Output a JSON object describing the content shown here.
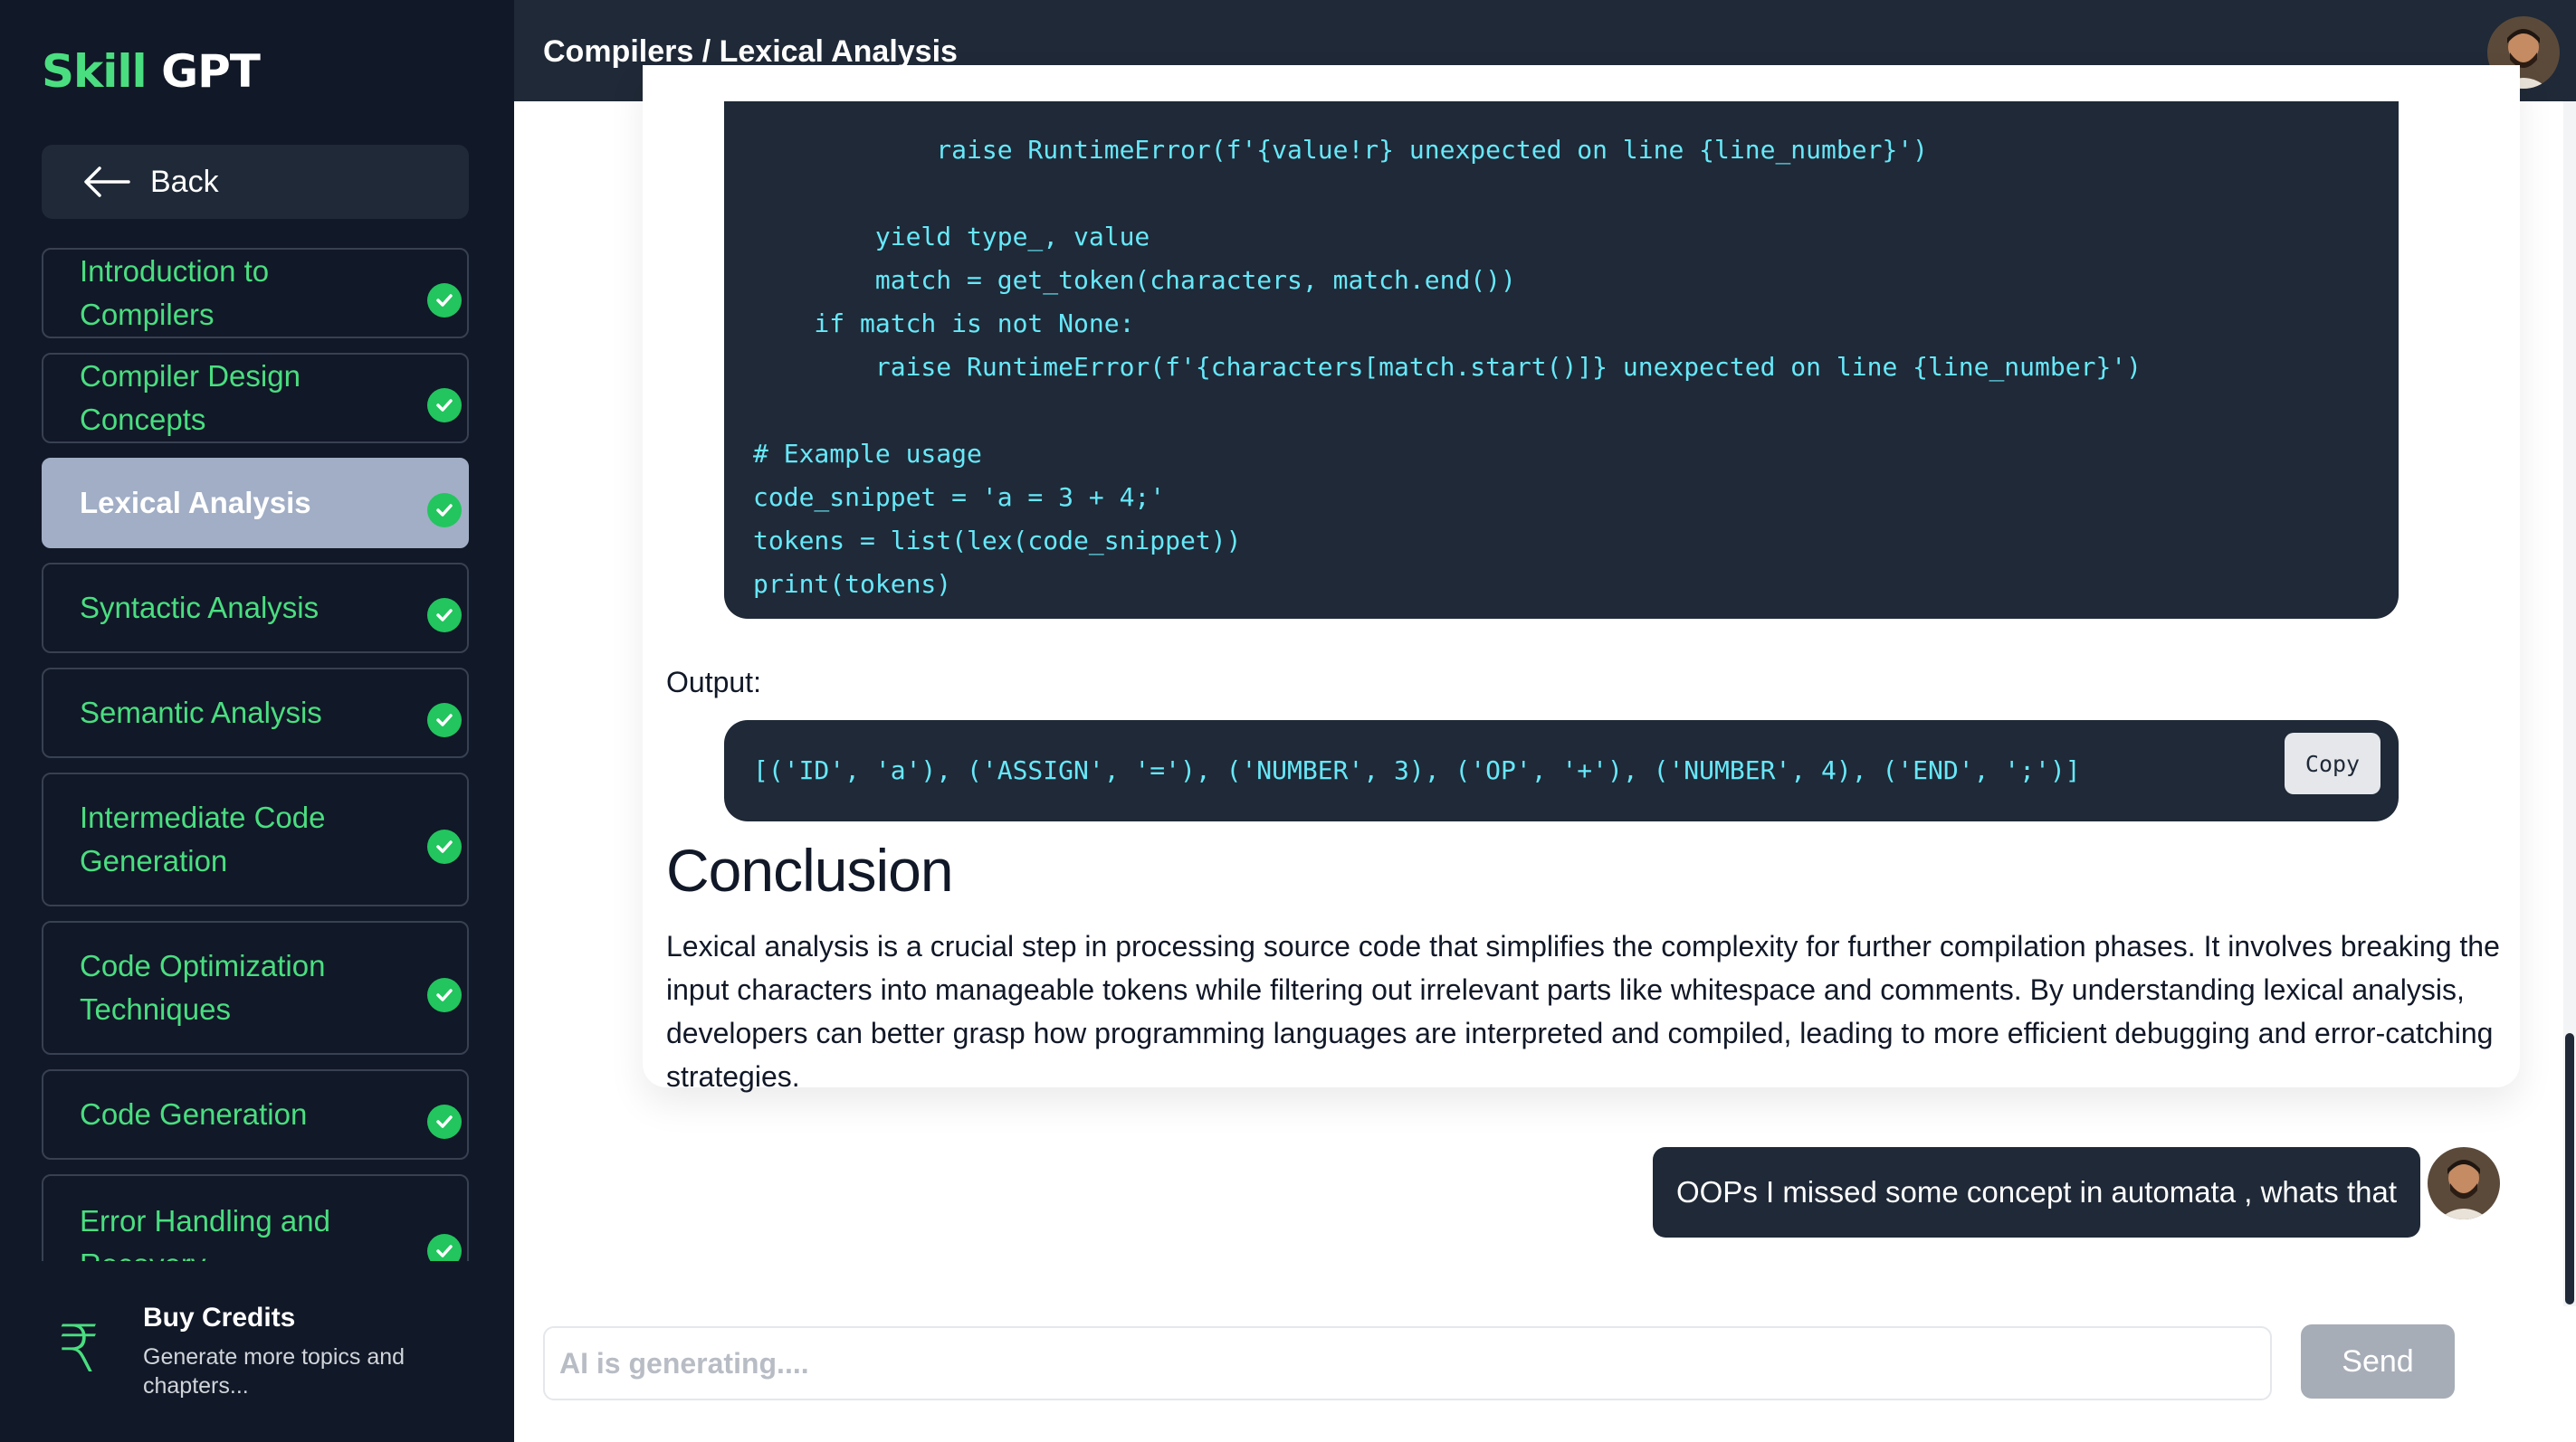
{
  "brand": {
    "part1": "Skill",
    "part2": "GPT"
  },
  "sidebar": {
    "back_label": "Back",
    "items": [
      {
        "label": "Introduction to Compilers",
        "completed": true
      },
      {
        "label": "Compiler Design Concepts",
        "completed": true
      },
      {
        "label": "Lexical Analysis",
        "completed": true,
        "active": true
      },
      {
        "label": "Syntactic Analysis",
        "completed": true
      },
      {
        "label": "Semantic Analysis",
        "completed": true
      },
      {
        "label": "Intermediate Code Generation",
        "completed": true
      },
      {
        "label": "Code Optimization Techniques",
        "completed": true
      },
      {
        "label": "Code Generation",
        "completed": true
      },
      {
        "label": "Error Handling and Recovery",
        "completed": true
      }
    ],
    "credits": {
      "icon": "rupee-icon",
      "title": "Buy Credits",
      "subtitle": "Generate more topics and chapters..."
    }
  },
  "header": {
    "breadcrumb": "Compilers / Lexical Analysis"
  },
  "content": {
    "code": "            raise RuntimeError(f'{value!r} unexpected on line {line_number}')\n\n        yield type_, value\n        match = get_token(characters, match.end())\n    if match is not None:\n        raise RuntimeError(f'{characters[match.start()]} unexpected on line {line_number}')\n\n# Example usage\ncode_snippet = 'a = 3 + 4;'\ntokens = list(lex(code_snippet))\nprint(tokens)",
    "output_label": "Output:",
    "output": "[('ID', 'a'), ('ASSIGN', '='), ('NUMBER', 3), ('OP', '+'), ('NUMBER', 4), ('END', ';')]",
    "copy_label": "Copy",
    "conclusion_title": "Conclusion",
    "conclusion_text": "Lexical analysis is a crucial step in processing source code that simplifies the complexity for further compilation phases. It involves breaking the input characters into manageable tokens while filtering out irrelevant parts like whitespace and comments. By understanding lexical analysis, developers can better grasp how programming languages are interpreted and compiled, leading to more efficient debugging and error-catching strategies."
  },
  "chat": {
    "user_message": "OOPs I missed some concept in automata , whats that",
    "input_placeholder": "AI is generating....",
    "input_value": "",
    "send_label": "Send"
  },
  "colors": {
    "sidebar_bg": "#111827",
    "accent_green": "#4ade80",
    "active_item": "#a1aec5",
    "code_bg": "#1f2937",
    "code_text": "#67e8f9"
  }
}
